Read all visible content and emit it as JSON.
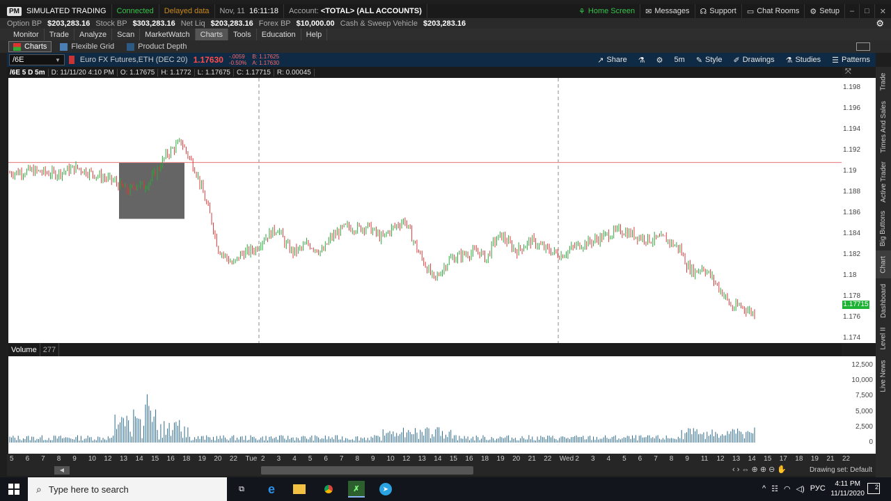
{
  "titlebar": {
    "badge": "PM",
    "mode": "SIMULATED TRADING",
    "connection": "Connected",
    "data_status": "Delayed data",
    "date": "Nov, 11",
    "time": "16:11:18",
    "account_label": "Account:",
    "account_value": "<TOTAL> (ALL ACCOUNTS)",
    "home_screen": "Home Screen",
    "messages": "Messages",
    "support": "Support",
    "chat_rooms": "Chat Rooms",
    "setup": "Setup"
  },
  "bpbar": [
    {
      "label": "Option BP",
      "value": "$203,283.16"
    },
    {
      "label": "Stock BP",
      "value": "$303,283.16"
    },
    {
      "label": "Net Liq",
      "value": "$203,283.16"
    },
    {
      "label": "Forex BP",
      "value": "$10,000.00"
    },
    {
      "label": "Cash & Sweep Vehicle",
      "value": "$203,283.16"
    }
  ],
  "menu": [
    "Monitor",
    "Trade",
    "Analyze",
    "Scan",
    "MarketWatch",
    "Charts",
    "Tools",
    "Education",
    "Help"
  ],
  "menu_active": "Charts",
  "subtabs": [
    "Charts",
    "Flexible Grid",
    "Product Depth"
  ],
  "chart_toolbar": {
    "symbol": "/6E",
    "description": "Euro FX Futures,ETH (DEC 20)",
    "last": "1.17630",
    "change": "-.0059",
    "change_pct": "-0.50%",
    "bid": "B: 1.17625",
    "ask": "A: 1.17630",
    "share": "Share",
    "timeframe": "5m",
    "style": "Style",
    "drawings": "Drawings",
    "studies": "Studies",
    "patterns": "Patterns"
  },
  "chart_header": {
    "period": "/6E 5 D 5m",
    "date": "D: 11/11/20 4:10 PM",
    "open": "O: 1.17675",
    "high": "H: 1.1772",
    "low": "L: 1.17675",
    "close": "C: 1.17715",
    "range": "R: 0.00045"
  },
  "volume_header": {
    "label": "Volume",
    "value": "277"
  },
  "last_price_label": "1.17715",
  "right_tabs": [
    "Trade",
    "Times And Sales",
    "Active Trader",
    "Big Buttons",
    "Chart",
    "Dashboard",
    "Level II",
    "Live News"
  ],
  "drawing_set": "Drawing set: Default",
  "taskbar": {
    "search_placeholder": "Type here to search",
    "lang": "РУС",
    "time": "4:11 PM",
    "date": "11/11/2020",
    "notif": "2"
  },
  "colors": {
    "up": "#2aa83a",
    "down": "#d93a3a",
    "volume": "#2b6a8c",
    "accent": "#0e2a44"
  },
  "chart_data": {
    "type": "line",
    "title": "",
    "ylabel": "",
    "ylim": [
      1.1735,
      1.1989
    ],
    "y_ticks": [
      "1.198",
      "1.196",
      "1.194",
      "1.192",
      "1.19",
      "1.188",
      "1.186",
      "1.184",
      "1.182",
      "1.18",
      "1.178",
      "1.176",
      "1.174"
    ],
    "x_ticks": [
      "5",
      "6",
      "7",
      "8",
      "9",
      "10",
      "12",
      "13",
      "14",
      "15",
      "16",
      "18",
      "19",
      "20",
      "22",
      "Tue",
      "2",
      "3",
      "4",
      "5",
      "6",
      "7",
      "8",
      "9",
      "10",
      "12",
      "13",
      "14",
      "15",
      "16",
      "18",
      "19",
      "20",
      "21",
      "22",
      "Wed",
      "2",
      "3",
      "4",
      "5",
      "6",
      "7",
      "8",
      "9",
      "11",
      "12",
      "13",
      "14",
      "15",
      "17",
      "18",
      "19",
      "21",
      "22"
    ],
    "price_series": {
      "name": "/6E",
      "x": [
        0,
        3,
        6,
        9,
        12,
        14,
        16,
        17,
        18,
        19,
        20,
        21,
        23,
        25,
        27,
        28,
        30,
        31,
        33,
        34,
        36,
        37,
        38,
        39,
        40,
        42,
        43,
        45,
        47,
        48,
        50,
        51,
        53,
        55,
        57,
        59,
        61,
        63,
        64,
        65,
        66,
        68,
        70,
        72,
        74,
        76,
        78,
        80,
        82,
        84,
        86,
        88,
        89,
        90,
        91,
        92,
        93,
        94,
        95,
        96,
        97,
        98,
        100
      ],
      "y": [
        1.1898,
        1.19,
        1.1897,
        1.1903,
        1.1895,
        1.189,
        1.188,
        1.1888,
        1.1885,
        1.1892,
        1.1903,
        1.1915,
        1.1928,
        1.19,
        1.1855,
        1.1825,
        1.181,
        1.182,
        1.1825,
        1.1835,
        1.1845,
        1.183,
        1.1822,
        1.1825,
        1.183,
        1.1822,
        1.1835,
        1.1846,
        1.1845,
        1.1847,
        1.1835,
        1.1843,
        1.1853,
        1.182,
        1.1795,
        1.1815,
        1.182,
        1.1823,
        1.1815,
        1.1832,
        1.1838,
        1.1823,
        1.1833,
        1.1825,
        1.1819,
        1.1828,
        1.1832,
        1.1838,
        1.1843,
        1.1838,
        1.1834,
        1.1835,
        1.183,
        1.1825,
        1.1808,
        1.1803,
        1.1808,
        1.18,
        1.179,
        1.178,
        1.1768,
        1.1771,
        1.1763
      ]
    },
    "resistance_level": 1.1908,
    "volume_series": {
      "name": "Volume",
      "ylim": [
        0,
        13500
      ],
      "y_ticks": [
        "12,500",
        "10,000",
        "7,500",
        "5,000",
        "2,500",
        "0"
      ]
    }
  }
}
